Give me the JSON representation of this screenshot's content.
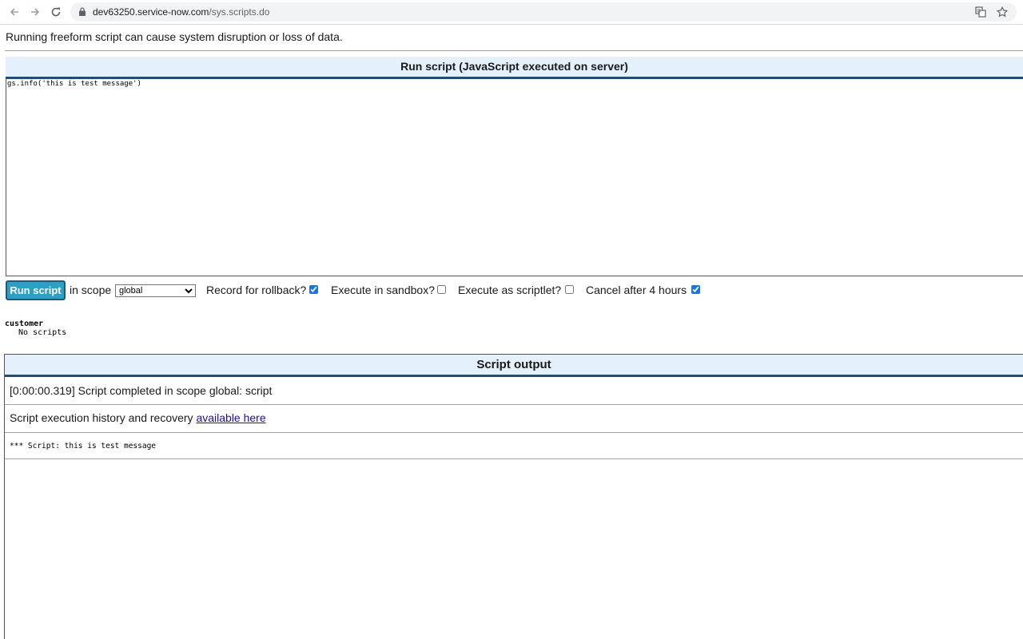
{
  "browser": {
    "url_host": "dev63250.service-now.com",
    "url_path": "/sys.scripts.do"
  },
  "page": {
    "warning": "Running freeform script can cause system disruption or loss of data.",
    "run_header": "Run script (JavaScript executed on server)",
    "script_text": "gs.info('this is test message')",
    "controls": {
      "run_button": "Run script",
      "in_scope": "in scope",
      "scope_value": "global",
      "record_rollback": "Record for rollback?",
      "record_rollback_checked": true,
      "execute_sandbox": "Execute in sandbox?",
      "execute_sandbox_checked": false,
      "execute_scriptlet": "Execute as scriptlet?",
      "execute_scriptlet_checked": false,
      "cancel_after": "Cancel after 4 hours",
      "cancel_after_checked": true
    },
    "scopes": {
      "name": "customer",
      "status": "No scripts"
    },
    "output": {
      "header": "Script output",
      "completed": "[0:00:00.319] Script completed in scope global: script",
      "history_prefix": "Script execution history and recovery ",
      "history_link": "available here",
      "log_line": "*** Script: this is test message"
    }
  },
  "colors": {
    "header_bg": "#e4f0fc",
    "header_border": "#1e4e79",
    "run_button_bg": "#2d9ec4",
    "link": "#1a0dab"
  }
}
